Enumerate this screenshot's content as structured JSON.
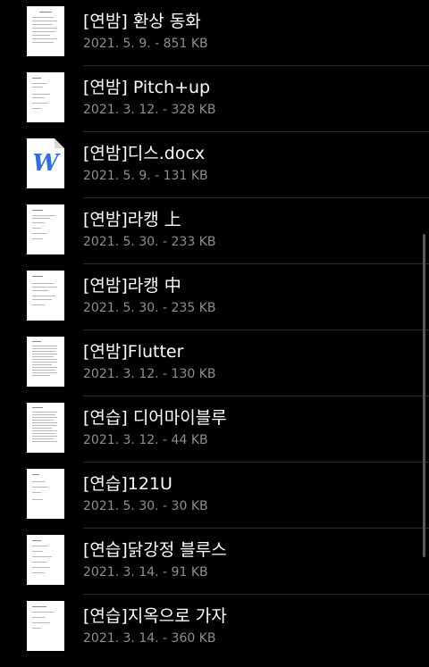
{
  "files": [
    {
      "title": "[연밤] 환상 동화",
      "meta": "2021. 5. 9. - 851 KB",
      "icon": "document-thumbnail-icon"
    },
    {
      "title": "[연밤] Pitch+up",
      "meta": "2021. 3. 12. - 328 KB",
      "icon": "document-thumbnail-icon"
    },
    {
      "title": "[연밤]디스.docx",
      "meta": "2021. 5. 9. - 131 KB",
      "icon": "word-document-icon"
    },
    {
      "title": "[연밤]라캥 上",
      "meta": "2021. 5. 30. - 233 KB",
      "icon": "document-thumbnail-icon"
    },
    {
      "title": "[연밤]라캥 中",
      "meta": "2021. 5. 30. - 235 KB",
      "icon": "document-thumbnail-icon"
    },
    {
      "title": "[연밤]Flutter",
      "meta": "2021. 3. 12. - 130 KB",
      "icon": "document-thumbnail-icon"
    },
    {
      "title": "[연습] 디어마이블루",
      "meta": "2021. 3. 12. - 44 KB",
      "icon": "document-thumbnail-icon"
    },
    {
      "title": "[연습]121U",
      "meta": "2021. 5. 30. - 30 KB",
      "icon": "document-thumbnail-icon"
    },
    {
      "title": "[연습]닭강정 블루스",
      "meta": "2021. 3. 14. - 91 KB",
      "icon": "document-thumbnail-icon"
    },
    {
      "title": "[연습]지옥으로 가자",
      "meta": "2021. 3. 14. - 360 KB",
      "icon": "document-thumbnail-icon"
    }
  ],
  "word_icon_letter": "W",
  "colors": {
    "background": "#000000",
    "title": "#ffffff",
    "meta": "#8e8e93",
    "separator": "#2c2c2e",
    "word_blue": "#2f6fd6"
  }
}
